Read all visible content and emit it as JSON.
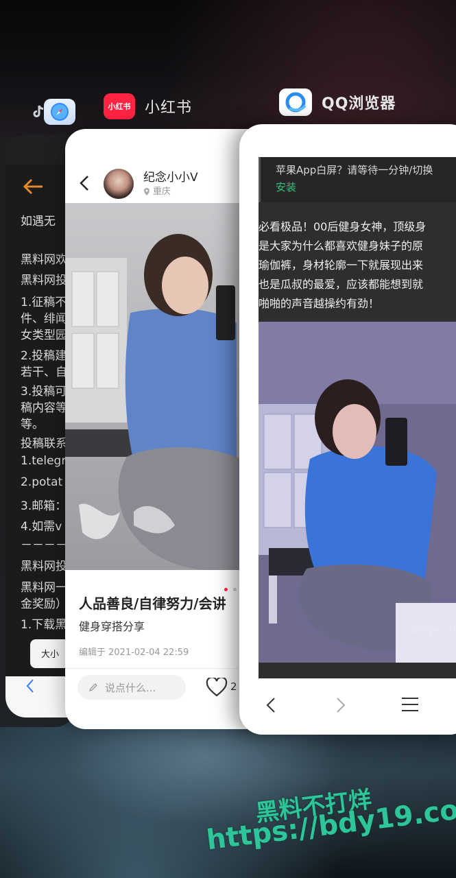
{
  "app_switcher": {
    "safari": {
      "icon": "safari-compass-icon",
      "lines": [
        "如遇无",
        "黑料网欢",
        "黑料网投",
        "1.征稿不",
        "件、绯闻",
        "女类型园",
        "2.投稿建",
        "若干、自",
        "3.投稿可",
        "稿内容等",
        "等。",
        "投稿联系",
        "1.telegr",
        "2.potat",
        "3.邮箱：",
        "4.如需v",
        "－－－－",
        "黑料网投",
        "黑料网一",
        "金奖励）",
        "1.下载黑"
      ],
      "bottom_button": "大小",
      "back_icon": "chevron-left-icon"
    },
    "xiaohongshu": {
      "app_name": "小红书",
      "icon_label": "小红书",
      "author": "纪念小小Ⅴ",
      "location": "重庆",
      "title": "人品善良/自律努力/会讲",
      "tags": "健身穿搭分享",
      "edit_date": "编辑于 2021-02-04 22:59",
      "comment_placeholder": "说点什么...",
      "like_count": "2",
      "colors": {
        "brand": "#ff2442"
      }
    },
    "qq_browser": {
      "app_name": "QQ浏览器",
      "banner_text": "苹果App白屏？请等待一分钟/切换",
      "install_link": "安装",
      "paragraph": [
        "必看极品！00后健身女神，顶级身",
        "是大家为什么都喜欢健身妹子的原",
        "瑜伽裤，身材轮廓一下就展现出来",
        "也是瓜叔的最爱，应该都能想到就",
        "啪啪的声音越操约有劲！"
      ],
      "image_watermark": "https://",
      "colors": {
        "accent": "#37a7ff"
      }
    }
  },
  "watermark": {
    "line1": "黑料不打烊",
    "line2": "https://bdy19.co"
  }
}
